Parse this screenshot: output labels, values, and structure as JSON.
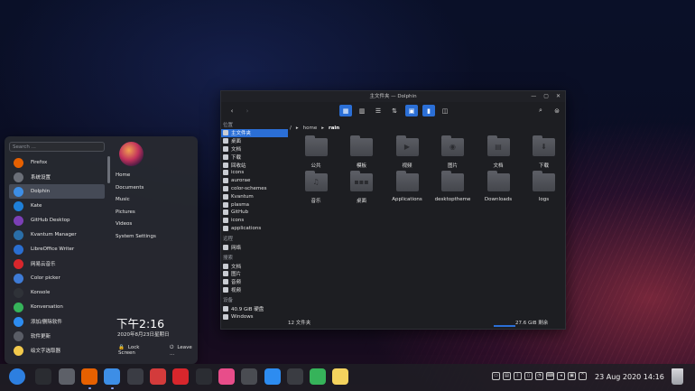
{
  "launcher": {
    "search_placeholder": "Search ...",
    "apps": [
      {
        "label": "Firefox",
        "icon": "firefox-icon",
        "color": "#e66000"
      },
      {
        "label": "系统设置",
        "icon": "settings-icon",
        "color": "#6b6f78"
      },
      {
        "label": "Dolphin",
        "icon": "dolphin-icon",
        "color": "#3d8ee6"
      },
      {
        "label": "Kate",
        "icon": "kate-icon",
        "color": "#1e7fd8"
      },
      {
        "label": "GitHub Desktop",
        "icon": "github-desktop-icon",
        "color": "#7b3fb5"
      },
      {
        "label": "Kvantum Manager",
        "icon": "kvantum-icon",
        "color": "#2a6ea8"
      },
      {
        "label": "LibreOffice Writer",
        "icon": "writer-icon",
        "color": "#2a6ed0"
      },
      {
        "label": "网易云音乐",
        "icon": "netease-music-icon",
        "color": "#d8262c"
      },
      {
        "label": "Color picker",
        "icon": "color-picker-icon",
        "color": "#3e7bd6"
      },
      {
        "label": "Konsole",
        "icon": "konsole-icon",
        "color": "#2f3238"
      },
      {
        "label": "Konversation",
        "icon": "konversation-icon",
        "color": "#36b35a"
      },
      {
        "label": "添加/删除软件",
        "icon": "software-store-icon",
        "color": "#2d8cf0"
      },
      {
        "label": "软件更新",
        "icon": "update-icon",
        "color": "#5a5d66"
      },
      {
        "label": "绘文字选取器",
        "icon": "emoji-picker-icon",
        "color": "#f2c94c"
      }
    ],
    "places": [
      "Home",
      "Documents",
      "Music",
      "Pictures",
      "Videos",
      "System Settings"
    ],
    "time": "下午2:16",
    "date": "2020年8月23日星期日",
    "lock_label": "Lock Screen",
    "leave_label": "Leave ..."
  },
  "dolphin": {
    "title": "主文件夹 — Dolphin",
    "sidebar": {
      "places_header": "位置",
      "places": [
        "主文件夹",
        "桌面",
        "文档",
        "下载",
        "回收站",
        "icons",
        "aurorae",
        "color-schemes",
        "Kvantum",
        "plasma",
        "GitHub",
        "icons",
        "applications"
      ],
      "remote_header": "远程",
      "remote": [
        "网络"
      ],
      "search_header": "搜索",
      "search": [
        "文档",
        "图片",
        "音频",
        "视频"
      ],
      "devices_header": "设备",
      "devices": [
        "40.9 GiB 硬盘",
        "Windows"
      ]
    },
    "breadcrumb": {
      "root": "/",
      "home": "home",
      "current": "rain"
    },
    "files": [
      {
        "label": "公共",
        "symbol": ""
      },
      {
        "label": "模板",
        "symbol": ""
      },
      {
        "label": "视频",
        "symbol": "▶"
      },
      {
        "label": "图片",
        "symbol": "◉"
      },
      {
        "label": "文档",
        "symbol": "▤"
      },
      {
        "label": "下载",
        "symbol": "⬇"
      },
      {
        "label": "音乐",
        "symbol": "♫"
      },
      {
        "label": "桌面",
        "symbol": "▪▪▪"
      },
      {
        "label": "Applications",
        "symbol": ""
      },
      {
        "label": "desktoptheme",
        "symbol": ""
      },
      {
        "label": "Downloads",
        "symbol": ""
      },
      {
        "label": "logs",
        "symbol": ""
      }
    ],
    "status_left": "12 文件夹",
    "status_right": "27.6 GiB 剩余"
  },
  "dock": {
    "icons": [
      "launcher-icon",
      "terminal-icon",
      "settings-icon",
      "firefox-icon",
      "dolphin-icon",
      "kvantum-icon",
      "music-icon",
      "netease-music-icon",
      "github-icon",
      "itunes-icon",
      "calculator-icon",
      "app-store-icon",
      "camera-icon",
      "messages-icon",
      "notes-icon"
    ],
    "clock": "23 Aug 2020 14:16"
  },
  "colors": {
    "accent": "#2b6fd6"
  }
}
